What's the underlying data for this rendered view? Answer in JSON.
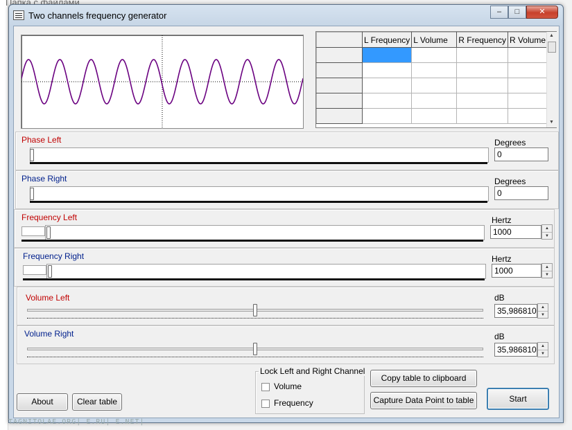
{
  "background": {
    "folder_title": "Папка с файлами",
    "watermark": "TAGNITOLAE.ORG| E.RU| E.NET|"
  },
  "window": {
    "title": "Two channels frequency generator",
    "minimize_label": "–",
    "maximize_label": "□",
    "close_label": "✕"
  },
  "scope": {
    "waveform": "sine",
    "wave_color": "#6a0080",
    "axis_style": "dotted"
  },
  "table": {
    "columns": [
      "L Frequency",
      "L Volume",
      "R Frequency",
      "R Volume"
    ],
    "selected_cell_color": "#3399ff"
  },
  "phase_left": {
    "label": "Phase Left",
    "unit": "Degrees",
    "value": "0",
    "color": "#c00000"
  },
  "phase_right": {
    "label": "Phase Right",
    "unit": "Degrees",
    "value": "0",
    "color": "#00208c"
  },
  "frequency_left": {
    "label": "Frequency Left",
    "unit": "Hertz",
    "value": "1000",
    "color": "#c00000"
  },
  "frequency_right": {
    "label": "Frequency Right",
    "unit": "Hertz",
    "value": "1000",
    "color": "#00208c"
  },
  "volume_left": {
    "label": "Volume Left",
    "unit": "dB",
    "value": "35,986810",
    "color": "#c00000"
  },
  "volume_right": {
    "label": "Volume Right",
    "unit": "dB",
    "value": "35,986810",
    "color": "#00208c"
  },
  "lock": {
    "title": "Lock Left and Right Channel",
    "volume_label": "Volume",
    "frequency_label": "Frequency",
    "volume_checked": false,
    "frequency_checked": false
  },
  "buttons": {
    "about": "About",
    "clear_table": "Clear table",
    "copy_table": "Copy table to clipboard",
    "capture": "Capture Data Point to table",
    "start": "Start"
  }
}
